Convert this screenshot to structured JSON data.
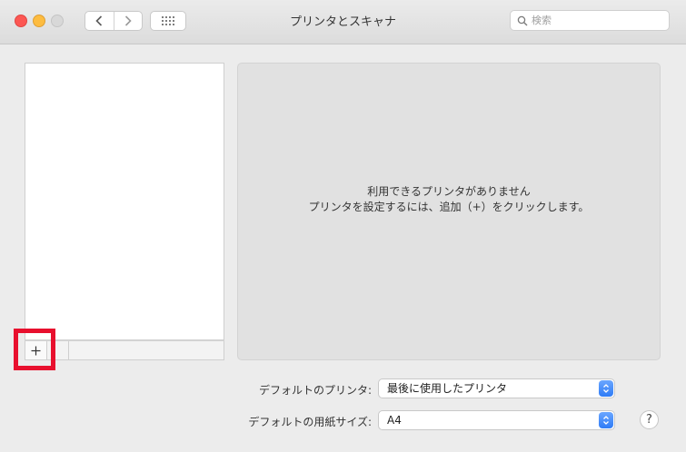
{
  "window": {
    "title": "プリンタとスキャナ"
  },
  "toolbar": {
    "back_icon": "chevron-left-icon",
    "forward_icon": "chevron-right-icon",
    "grid_icon": "show-all-grid-icon"
  },
  "search": {
    "placeholder": "検索",
    "value": ""
  },
  "printer_list": {
    "items": [],
    "add_label": "+"
  },
  "detail": {
    "message_line1": "利用できるプリンタがありません",
    "message_line2": "プリンタを設定するには、追加（+）をクリックします。"
  },
  "options": {
    "default_printer_label": "デフォルトのプリンタ:",
    "default_printer_value": "最後に使用したプリンタ",
    "default_paper_label": "デフォルトの用紙サイズ:",
    "default_paper_value": "A4"
  },
  "help": {
    "label": "?"
  },
  "colors": {
    "highlight": "#e8102e",
    "accent": "#2f7cf6"
  }
}
